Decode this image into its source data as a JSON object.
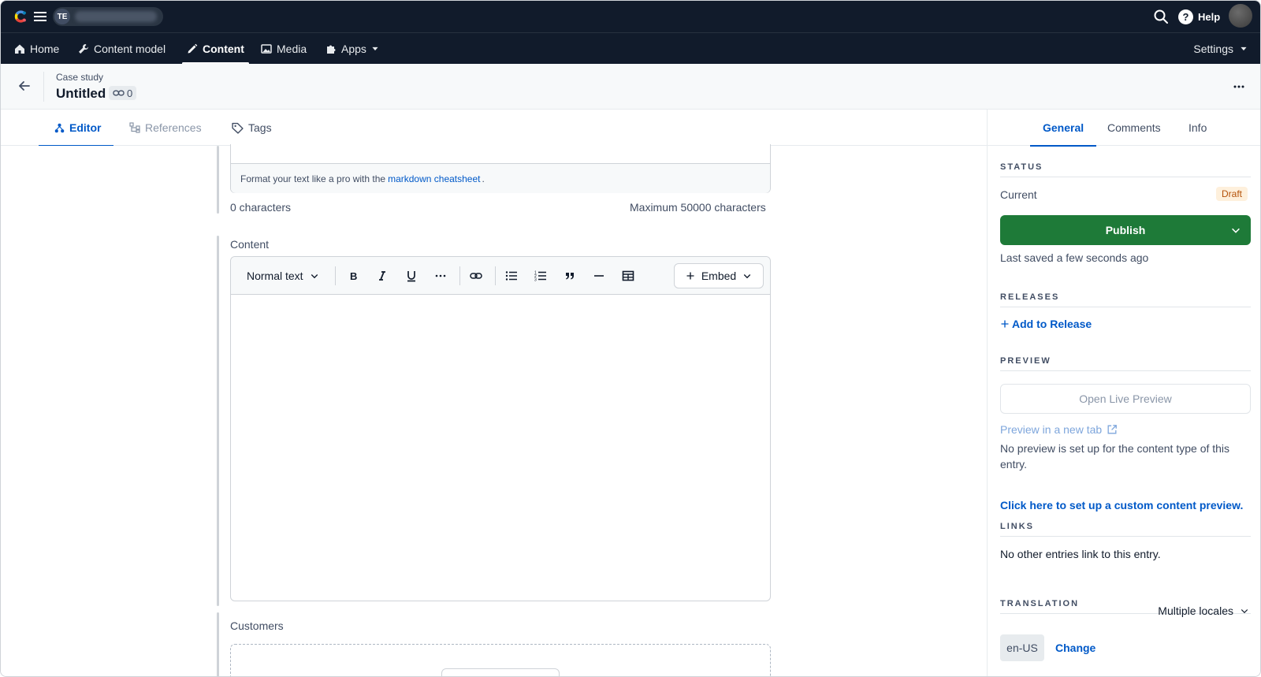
{
  "topbar": {
    "space_initials": "TE",
    "help_label": "Help"
  },
  "nav": {
    "items": [
      {
        "label": "Home",
        "icon": "home-icon"
      },
      {
        "label": "Content model",
        "icon": "wrench-icon"
      },
      {
        "label": "Content",
        "icon": "pencil-icon",
        "active": true
      },
      {
        "label": "Media",
        "icon": "image-icon"
      },
      {
        "label": "Apps",
        "icon": "puzzle-icon"
      }
    ],
    "settings_label": "Settings"
  },
  "entry": {
    "content_type": "Case study",
    "title": "Untitled",
    "references_count": "0"
  },
  "tabs": [
    {
      "label": "Editor",
      "active": true
    },
    {
      "label": "References"
    },
    {
      "label": "Tags"
    }
  ],
  "editor": {
    "markdown_hint_before": "Format your text like a pro with the",
    "markdown_link": "markdown cheatsheet",
    "markdown_hint_after": ".",
    "char_count": "0 characters",
    "char_max": "Maximum 50000 characters",
    "content_label": "Content",
    "toolbar": {
      "text_style": "Normal text",
      "embed_label": "Embed"
    },
    "customers_label": "Customers"
  },
  "sidebar": {
    "tabs": [
      {
        "label": "General",
        "active": true
      },
      {
        "label": "Comments"
      },
      {
        "label": "Info"
      }
    ],
    "status": {
      "heading": "STATUS",
      "current_label": "Current",
      "badge": "Draft",
      "publish_label": "Publish",
      "last_saved": "Last saved a few seconds ago"
    },
    "releases": {
      "heading": "RELEASES",
      "add_label": "Add to Release"
    },
    "preview": {
      "heading": "PREVIEW",
      "open_live": "Open Live Preview",
      "new_tab": "Preview in a new tab",
      "no_preview": "No preview is set up for the content type of this entry.",
      "setup_link": "Click here to set up a custom content preview."
    },
    "links": {
      "heading": "LINKS",
      "text": "No other entries link to this entry."
    },
    "translation": {
      "heading": "TRANSLATION",
      "mode": "Multiple locales",
      "locale": "en-US",
      "change_label": "Change"
    }
  },
  "colors": {
    "topbar_bg": "#111b2b",
    "accent_blue": "#0059c8",
    "publish_green": "#1e7a38",
    "draft_bg": "#fef0dc",
    "draft_text": "#b4520a"
  }
}
